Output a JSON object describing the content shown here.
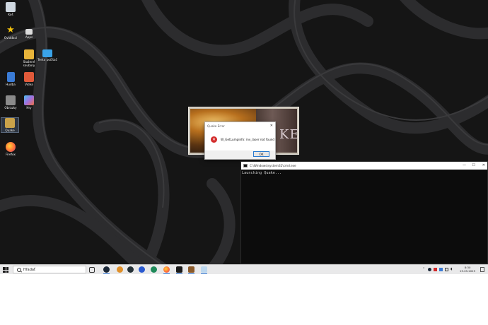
{
  "desktop": {
    "icons": [
      {
        "label": "Koš",
        "icon": "recycle-bin-icon",
        "color": "#cfd8e0"
      },
      {
        "label": "Ovládací",
        "icon": "star-icon",
        "color": "#f4c20d"
      },
      {
        "label": "Apps",
        "icon": "apps-icon",
        "color": "#dcdcdc"
      },
      {
        "label": "Stažené soubory",
        "icon": "downloads-folder-icon",
        "color": "#e8b43a"
      },
      {
        "label": "Tento počítač",
        "icon": "this-pc-icon",
        "color": "#3aa3e8"
      },
      {
        "label": "Hudba",
        "icon": "music-icon",
        "color": "#3a7bd5"
      },
      {
        "label": "Videa",
        "icon": "videos-icon",
        "color": "#e05a3a"
      },
      {
        "label": "Obrázky",
        "icon": "pictures-icon",
        "color": "#8a8a8a"
      },
      {
        "label": "Hry",
        "icon": "games-icon",
        "color": "#a070e0"
      },
      {
        "label": "Quake",
        "icon": "quake-icon",
        "color": "#c9a24a"
      },
      {
        "label": "Firefox",
        "icon": "firefox-icon",
        "color": "#ff7139"
      }
    ]
  },
  "splash": {
    "logo_text": "KE"
  },
  "error_dialog": {
    "title": "Quake Error",
    "message": "W_GetLumpinfo: inv_laser not found",
    "ok_label": "OK"
  },
  "console": {
    "title": "C:\\Windows\\system32\\cmd.exe",
    "output": "Launching Quake...",
    "minimize": "—",
    "maximize": "☐",
    "close": "✕"
  },
  "taskbar": {
    "search_label": "Hľadať",
    "apps": [
      {
        "icon": "task-view-icon",
        "color": "#333333"
      },
      {
        "icon": "steam-icon",
        "color": "#1b2838"
      },
      {
        "icon": "app-orange-icon",
        "color": "#e0902a"
      },
      {
        "icon": "app-dark-icon",
        "color": "#263238"
      },
      {
        "icon": "app-blue-icon",
        "color": "#2a5ad0"
      },
      {
        "icon": "app-green-icon",
        "color": "#1f8a5a"
      },
      {
        "icon": "firefox-icon",
        "color": "#ff7139"
      },
      {
        "icon": "terminal-icon",
        "color": "#1a1a1a"
      },
      {
        "icon": "quake-icon",
        "color": "#8a5a2a"
      },
      {
        "icon": "notepad-icon",
        "color": "#bcd7ee"
      }
    ],
    "time": "8:30",
    "date": "23.05.2025"
  },
  "colors": {
    "accent": "#3a7bd5",
    "error": "#d32a2a"
  }
}
